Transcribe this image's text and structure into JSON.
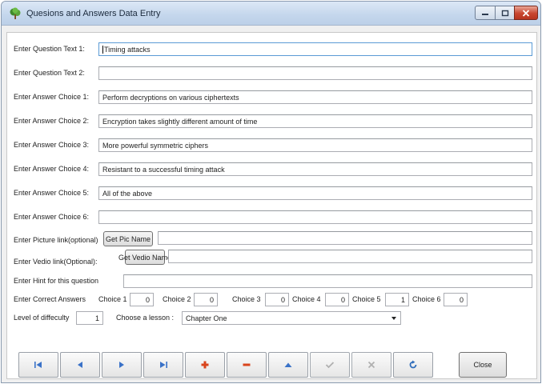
{
  "window": {
    "title": "Quesions and Answers Data Entry",
    "icon": "tree-app-icon"
  },
  "form": {
    "question1": {
      "label": "Enter Question Text 1:",
      "value": "Timing attacks"
    },
    "question2": {
      "label": "Enter Question Text 2:",
      "value": ""
    },
    "choices": [
      {
        "label": "Enter Answer Choice 1:",
        "value": "Perform decryptions on various ciphertexts"
      },
      {
        "label": "Enter Answer Choice 2:",
        "value": "Encryption takes slightly different amount of time"
      },
      {
        "label": "Enter Answer Choice 3:",
        "value": "More powerful symmetric ciphers"
      },
      {
        "label": "Enter Answer Choice 4:",
        "value": "Resistant to a successful timing attack"
      },
      {
        "label": "Enter Answer Choice 5:",
        "value": "All of the above"
      },
      {
        "label": "Enter Answer Choice 6:",
        "value": ""
      }
    ],
    "picture": {
      "label": "Enter Picture link(optional)",
      "button": "Get Pic Name",
      "value": ""
    },
    "video": {
      "label": "Enter Vedio link(Optional):",
      "button": "Get Vedio Name",
      "value": ""
    },
    "hint": {
      "label": "Enter Hint for this question",
      "value": ""
    },
    "correct": {
      "label": "Enter Correct Answers",
      "choices": [
        {
          "label": "Choice 1",
          "value": "0"
        },
        {
          "label": "Choice 2",
          "value": "0"
        },
        {
          "label": "Choice 3",
          "value": "0"
        },
        {
          "label": "Choice 4",
          "value": "0"
        },
        {
          "label": "Choice 5",
          "value": "1"
        },
        {
          "label": "Choice 6",
          "value": "0"
        }
      ]
    },
    "difficulty": {
      "label": "Level of diffeculty",
      "value": "1"
    },
    "lesson": {
      "label": "Choose a  lesson :",
      "selected": "Chapter One"
    }
  },
  "navigator": {
    "buttons": [
      "first-record-icon",
      "prior-record-icon",
      "next-record-icon",
      "last-record-icon",
      "insert-record-icon",
      "delete-record-icon",
      "edit-record-icon",
      "post-edit-icon",
      "cancel-edit-icon",
      "refresh-data-icon"
    ],
    "colors": {
      "nav": "#3a72c8",
      "add_delete": "#d9441c",
      "disabled": "#a8a8a8",
      "refresh": "#2f6dbb"
    }
  },
  "close_button": "Close"
}
